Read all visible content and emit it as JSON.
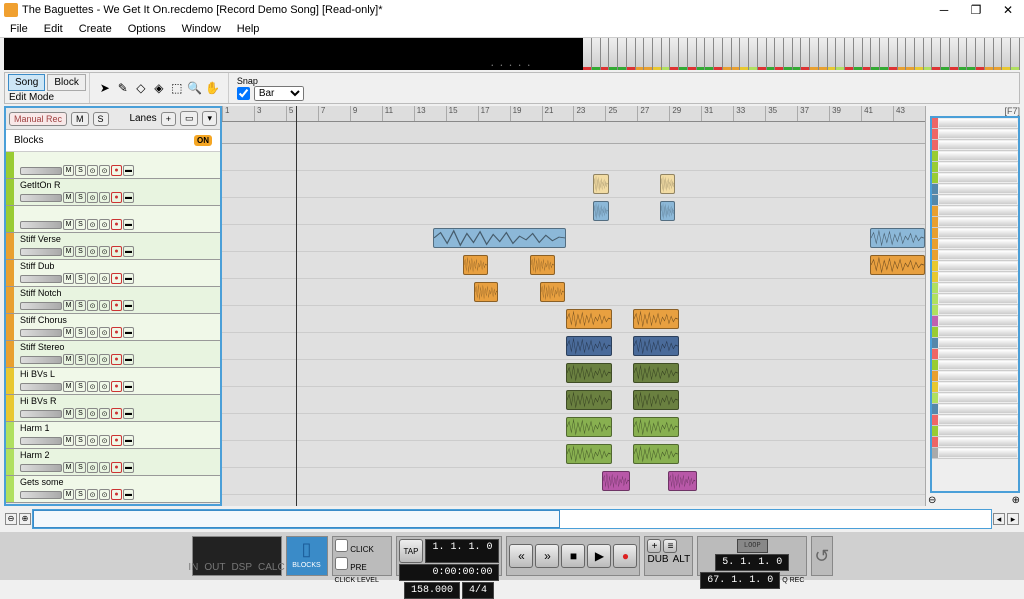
{
  "title": "The Baguettes - We Get It On.recdemo [Record Demo Song] [Read-only]*",
  "menu": [
    "File",
    "Edit",
    "Create",
    "Options",
    "Window",
    "Help"
  ],
  "toolbar": {
    "song": "Song",
    "block": "Block",
    "editmode": "Edit Mode",
    "snap_label": "Snap",
    "snap_value": "Bar"
  },
  "panel": {
    "manual_rec": "Manual Rec",
    "lanes": "Lanes",
    "blocks": "Blocks",
    "on": "ON",
    "m": "M",
    "s": "S"
  },
  "tracks": [
    {
      "name": "",
      "color": "#9c3",
      "clips": []
    },
    {
      "name": "GetItOn R",
      "color": "#9c3",
      "clips": [
        {
          "s": 0.528,
          "w": 0.022,
          "c": "#f2dca4"
        },
        {
          "s": 0.623,
          "w": 0.022,
          "c": "#f2dca4"
        }
      ]
    },
    {
      "name": "",
      "color": "#9c3",
      "clips": [
        {
          "s": 0.528,
          "w": 0.022,
          "c": "#8cb8d8"
        },
        {
          "s": 0.623,
          "w": 0.022,
          "c": "#8cb8d8"
        }
      ]
    },
    {
      "name": "Stiff Verse",
      "color": "#e8a030",
      "clips": [
        {
          "s": 0.3,
          "w": 0.19,
          "c": "#8cb8d8"
        },
        {
          "s": 0.922,
          "w": 0.078,
          "c": "#8cb8d8"
        }
      ]
    },
    {
      "name": "Stiff Dub",
      "color": "#e8a030",
      "clips": [
        {
          "s": 0.343,
          "w": 0.035,
          "c": "#e8a040"
        },
        {
          "s": 0.438,
          "w": 0.035,
          "c": "#e8a040"
        },
        {
          "s": 0.922,
          "w": 0.078,
          "c": "#e8a040"
        }
      ]
    },
    {
      "name": "Stiff Notch",
      "color": "#e8a030",
      "clips": [
        {
          "s": 0.358,
          "w": 0.035,
          "c": "#e8a040"
        },
        {
          "s": 0.453,
          "w": 0.035,
          "c": "#e8a040"
        }
      ]
    },
    {
      "name": "Stiff Chorus",
      "color": "#e8a030",
      "clips": [
        {
          "s": 0.49,
          "w": 0.065,
          "c": "#e8a040"
        },
        {
          "s": 0.585,
          "w": 0.065,
          "c": "#e8a040"
        }
      ]
    },
    {
      "name": "Stiff Stereo",
      "color": "#e8a030",
      "clips": [
        {
          "s": 0.49,
          "w": 0.065,
          "c": "#4a6b9a"
        },
        {
          "s": 0.585,
          "w": 0.065,
          "c": "#4a6b9a"
        }
      ]
    },
    {
      "name": "Hi BVs L",
      "color": "#e8c830",
      "clips": [
        {
          "s": 0.49,
          "w": 0.065,
          "c": "#6a8040"
        },
        {
          "s": 0.585,
          "w": 0.065,
          "c": "#6a8040"
        }
      ]
    },
    {
      "name": "Hi BVs R",
      "color": "#e8c830",
      "clips": [
        {
          "s": 0.49,
          "w": 0.065,
          "c": "#6a8040"
        },
        {
          "s": 0.585,
          "w": 0.065,
          "c": "#6a8040"
        }
      ]
    },
    {
      "name": "Harm 1",
      "color": "#b0e060",
      "clips": [
        {
          "s": 0.49,
          "w": 0.065,
          "c": "#88b050"
        },
        {
          "s": 0.585,
          "w": 0.065,
          "c": "#88b050"
        }
      ]
    },
    {
      "name": "Harm 2",
      "color": "#b0e060",
      "clips": [
        {
          "s": 0.49,
          "w": 0.065,
          "c": "#88b050"
        },
        {
          "s": 0.585,
          "w": 0.065,
          "c": "#88b050"
        }
      ]
    },
    {
      "name": "Gets some",
      "color": "#b0e060",
      "clips": [
        {
          "s": 0.54,
          "w": 0.04,
          "c": "#b858a8"
        },
        {
          "s": 0.635,
          "w": 0.04,
          "c": "#b858a8"
        }
      ]
    }
  ],
  "bars": [
    1,
    3,
    5,
    7,
    9,
    11,
    13,
    15,
    17,
    19,
    21,
    23,
    25,
    27,
    29,
    31,
    33,
    35,
    37,
    39,
    41,
    43
  ],
  "transport": {
    "click": "CLICK",
    "pre": "PRE",
    "tap": "TAP",
    "click_level": "CLICK LEVEL",
    "pos": "1. 1. 1. 0",
    "time": "0:00:00:00",
    "tempo": "158.000",
    "sig": "4/4",
    "dub": "DUB",
    "alt": "ALT",
    "loop": "LOOP",
    "qrec": "Q REC",
    "pos2": "5. 1. 1. 0",
    "pos3": "67. 1. 1. 0",
    "in": "IN",
    "out": "OUT",
    "dsp": "DSP",
    "calc": "CALC",
    "blocks": "BLOCKS",
    "f7": "[F7]"
  },
  "minimap_colors": [
    "#e66",
    "#e66",
    "#e66",
    "#9c3",
    "#9c3",
    "#9c3",
    "#58a",
    "#58a",
    "#e8a030",
    "#e8a030",
    "#e8a030",
    "#e8a030",
    "#e8a030",
    "#e8c830",
    "#e8c830",
    "#b0e060",
    "#b0e060",
    "#b0e060",
    "#c060b0",
    "#9c3",
    "#58a",
    "#e66",
    "#9c3",
    "#e8a030",
    "#e8c830",
    "#b0e060",
    "#58a",
    "#e66",
    "#9c3",
    "#e66",
    "#aaa"
  ]
}
